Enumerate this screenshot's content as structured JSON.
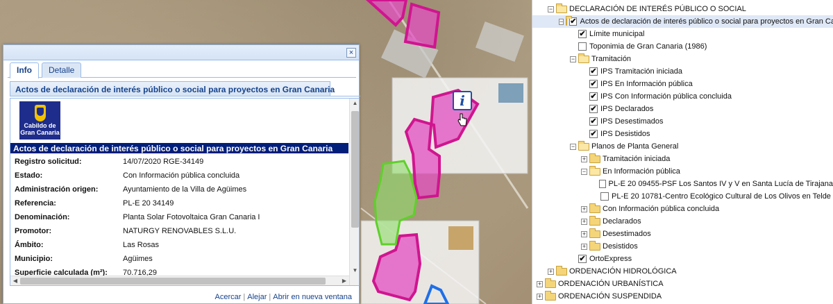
{
  "popup": {
    "tabs": [
      "Info",
      "Detalle"
    ],
    "subtab_title": "Actos de declaración de interés público o social para proyectos en Gran Canaria",
    "logo_text": [
      "Cabildo de",
      "Gran Canaria"
    ],
    "record_title": "Actos de declaración de interés público o social para proyectos en Gran Canaria",
    "rows": [
      {
        "k": "Registro solicitud:",
        "v": "14/07/2020 RGE-34149"
      },
      {
        "k": "Estado:",
        "v": "Con Información pública concluida"
      },
      {
        "k": "Administración origen:",
        "v": "Ayuntamiento de la Villa de Agüimes"
      },
      {
        "k": "Referencia:",
        "v": "PL-E 20 34149"
      },
      {
        "k": "Denominación:",
        "v": "Planta Solar Fotovoltaica Gran Canaria I"
      },
      {
        "k": "Promotor:",
        "v": "NATURGY RENOVABLES S.L.U."
      },
      {
        "k": "Ámbito:",
        "v": "Las Rosas"
      },
      {
        "k": "Municipio:",
        "v": "Agüimes"
      },
      {
        "k": "Superficie calculada (m²):",
        "v": "70.716,29"
      }
    ],
    "links": [
      "Acercar",
      "Alejar",
      "Abrir en nueva ventana"
    ],
    "close_glyph": "×"
  },
  "map": {
    "info_marker": "i"
  },
  "tree": [
    {
      "label": "DECLARACIÓN DE INTERÉS PÚBLICO O SOCIAL",
      "exp": "−",
      "folder": true,
      "open": true,
      "check": null,
      "lvl": 1
    },
    {
      "label": "Actos de declaración de interés público o social para proyectos en Gran Canaria",
      "exp": "−",
      "folder": true,
      "open": true,
      "check": true,
      "lvl": 2,
      "sel": true
    },
    {
      "label": "Límite municipal",
      "exp": null,
      "folder": false,
      "check": true,
      "lvl": 3
    },
    {
      "label": "Toponimia de Gran Canaria (1986)",
      "exp": null,
      "folder": false,
      "check": false,
      "lvl": 3
    },
    {
      "label": "Tramitación",
      "exp": "−",
      "folder": true,
      "open": true,
      "check": null,
      "lvl": 3
    },
    {
      "label": "IPS Tramitación iniciada",
      "exp": null,
      "folder": false,
      "check": true,
      "lvl": 4
    },
    {
      "label": "IPS En Información pública",
      "exp": null,
      "folder": false,
      "check": true,
      "lvl": 4
    },
    {
      "label": "IPS Con Información pública concluida",
      "exp": null,
      "folder": false,
      "check": true,
      "lvl": 4
    },
    {
      "label": "IPS Declarados",
      "exp": null,
      "folder": false,
      "check": true,
      "lvl": 4
    },
    {
      "label": "IPS Desestimados",
      "exp": null,
      "folder": false,
      "check": true,
      "lvl": 4
    },
    {
      "label": "IPS Desistidos",
      "exp": null,
      "folder": false,
      "check": true,
      "lvl": 4
    },
    {
      "label": "Planos de Planta General",
      "exp": "−",
      "folder": true,
      "open": true,
      "check": null,
      "lvl": 3
    },
    {
      "label": "Tramitación iniciada",
      "exp": "+",
      "folder": true,
      "open": false,
      "check": null,
      "lvl": 4
    },
    {
      "label": "En Información pública",
      "exp": "−",
      "folder": true,
      "open": true,
      "check": null,
      "lvl": 4
    },
    {
      "label": "PL-E 20 09455-PSF Los Santos IV y V en Santa Lucía de Tirajana",
      "exp": null,
      "folder": false,
      "check": false,
      "lvl": 5
    },
    {
      "label": "PL-E 20 10781-Centro Ecológico Cultural de Los Olivos en Telde",
      "exp": null,
      "folder": false,
      "check": false,
      "lvl": 5
    },
    {
      "label": "Con Información pública concluida",
      "exp": "+",
      "folder": true,
      "open": false,
      "check": null,
      "lvl": 4
    },
    {
      "label": "Declarados",
      "exp": "+",
      "folder": true,
      "open": false,
      "check": null,
      "lvl": 4
    },
    {
      "label": "Desestimados",
      "exp": "+",
      "folder": true,
      "open": false,
      "check": null,
      "lvl": 4
    },
    {
      "label": "Desistidos",
      "exp": "+",
      "folder": true,
      "open": false,
      "check": null,
      "lvl": 4
    },
    {
      "label": "OrtoExpress",
      "exp": null,
      "folder": false,
      "check": true,
      "lvl": 3
    },
    {
      "label": "ORDENACIÓN HIDROLÓGICA",
      "exp": "+",
      "folder": true,
      "open": false,
      "check": null,
      "lvl": 1
    },
    {
      "label": "ORDENACIÓN URBANÍSTICA",
      "exp": "+",
      "folder": true,
      "open": false,
      "check": null,
      "lvl": 0
    },
    {
      "label": "ORDENACIÓN SUSPENDIDA",
      "exp": "+",
      "folder": true,
      "open": false,
      "check": null,
      "lvl": 0
    }
  ]
}
